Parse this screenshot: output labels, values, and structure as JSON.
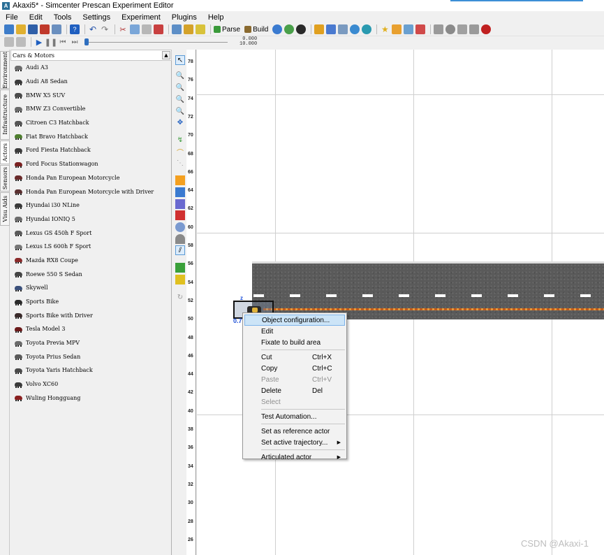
{
  "window": {
    "title": "Akaxi5* - Simcenter Prescan Experiment Editor",
    "app_icon": "prescan-icon"
  },
  "menubar": [
    "File",
    "Edit",
    "Tools",
    "Settings",
    "Experiment",
    "Plugins",
    "Help"
  ],
  "toolbar": {
    "parse_label": "Parse",
    "build_label": "Build",
    "time_value": "0.000",
    "time_end": "10.000"
  },
  "side_tabs": [
    "Environment",
    "Infrastructure",
    "Actors",
    "Sensors",
    "Visu Aids"
  ],
  "active_side_tab": "Actors",
  "library": {
    "header": "Cars & Motors",
    "items": [
      {
        "label": "Audi A3",
        "color": "#6b6b6b"
      },
      {
        "label": "Audi A8 Sedan",
        "color": "#3a3a3a"
      },
      {
        "label": "BMW X5 SUV",
        "color": "#4a4a4a"
      },
      {
        "label": "BMW Z3 Convertible",
        "color": "#6a6a6a"
      },
      {
        "label": "Citroen C3 Hatchback",
        "color": "#555555"
      },
      {
        "label": "Fiat Bravo Hatchback",
        "color": "#4f7f2f"
      },
      {
        "label": "Ford Fiesta Hatchback",
        "color": "#3c3c3c"
      },
      {
        "label": "Ford Focus Stationwagon",
        "color": "#7a2020"
      },
      {
        "label": "Honda Pan European Motorcycle",
        "color": "#6a2a2a"
      },
      {
        "label": "Honda Pan European Motorcycle with Driver",
        "color": "#5a3030"
      },
      {
        "label": "Hyundai i30 NLine",
        "color": "#3a3a3a"
      },
      {
        "label": "Hyundai IONIQ 5",
        "color": "#6c6c6c"
      },
      {
        "label": "Lexus GS 450h F Sport",
        "color": "#5a5a5a"
      },
      {
        "label": "Lexus LS 600h F Sport",
        "color": "#777777"
      },
      {
        "label": "Mazda RX8 Coupe",
        "color": "#8a2a2a"
      },
      {
        "label": "Roewe 550 S Sedan",
        "color": "#444444"
      },
      {
        "label": "Skywell",
        "color": "#3a4f7a"
      },
      {
        "label": "Sports Bike",
        "color": "#2a2a2a"
      },
      {
        "label": "Sports Bike with Driver",
        "color": "#3a2a2a"
      },
      {
        "label": "Tesla Model 3",
        "color": "#6b1a1a"
      },
      {
        "label": "Toyota Previa MPV",
        "color": "#6a6a6a"
      },
      {
        "label": "Toyota Prius Sedan",
        "color": "#5a5a5a"
      },
      {
        "label": "Toyota Yaris Hatchback",
        "color": "#4a4a4a"
      },
      {
        "label": "Volvo XC60",
        "color": "#3a3a3a"
      },
      {
        "label": "Wuling Hongguang",
        "color": "#8a2020"
      }
    ]
  },
  "ruler_ticks": [
    "78",
    "76",
    "74",
    "72",
    "70",
    "68",
    "66",
    "64",
    "62",
    "60",
    "58",
    "56",
    "54",
    "52",
    "50",
    "48",
    "46",
    "44",
    "42",
    "40",
    "38",
    "36",
    "34",
    "32",
    "30",
    "28",
    "26"
  ],
  "scene": {
    "actor_axis_label": "z",
    "actor_label": "0.7"
  },
  "context_menu": {
    "items": [
      {
        "label": "Object configuration...",
        "shortcut": "",
        "submenu": false,
        "disabled": false,
        "highlight": true
      },
      {
        "label": "Edit",
        "shortcut": "",
        "submenu": false,
        "disabled": false
      },
      {
        "label": "Fixate to build area",
        "shortcut": "",
        "submenu": false,
        "disabled": false
      },
      {
        "label": "Cut",
        "shortcut": "Ctrl+X",
        "submenu": false,
        "disabled": false
      },
      {
        "label": "Copy",
        "shortcut": "Ctrl+C",
        "submenu": false,
        "disabled": false
      },
      {
        "label": "Paste",
        "shortcut": "Ctrl+V",
        "submenu": false,
        "disabled": true
      },
      {
        "label": "Delete",
        "shortcut": "Del",
        "submenu": false,
        "disabled": false
      },
      {
        "label": "Select",
        "shortcut": "",
        "submenu": false,
        "disabled": true
      },
      {
        "label": "Test Automation...",
        "shortcut": "",
        "submenu": false,
        "disabled": false
      },
      {
        "label": "Set as reference actor",
        "shortcut": "",
        "submenu": false,
        "disabled": false
      },
      {
        "label": "Set active trajectory...",
        "shortcut": "",
        "submenu": true,
        "disabled": false
      },
      {
        "label": "Articulated actor",
        "shortcut": "",
        "submenu": true,
        "disabled": false
      }
    ]
  },
  "watermark": "CSDN @Akaxi-1"
}
